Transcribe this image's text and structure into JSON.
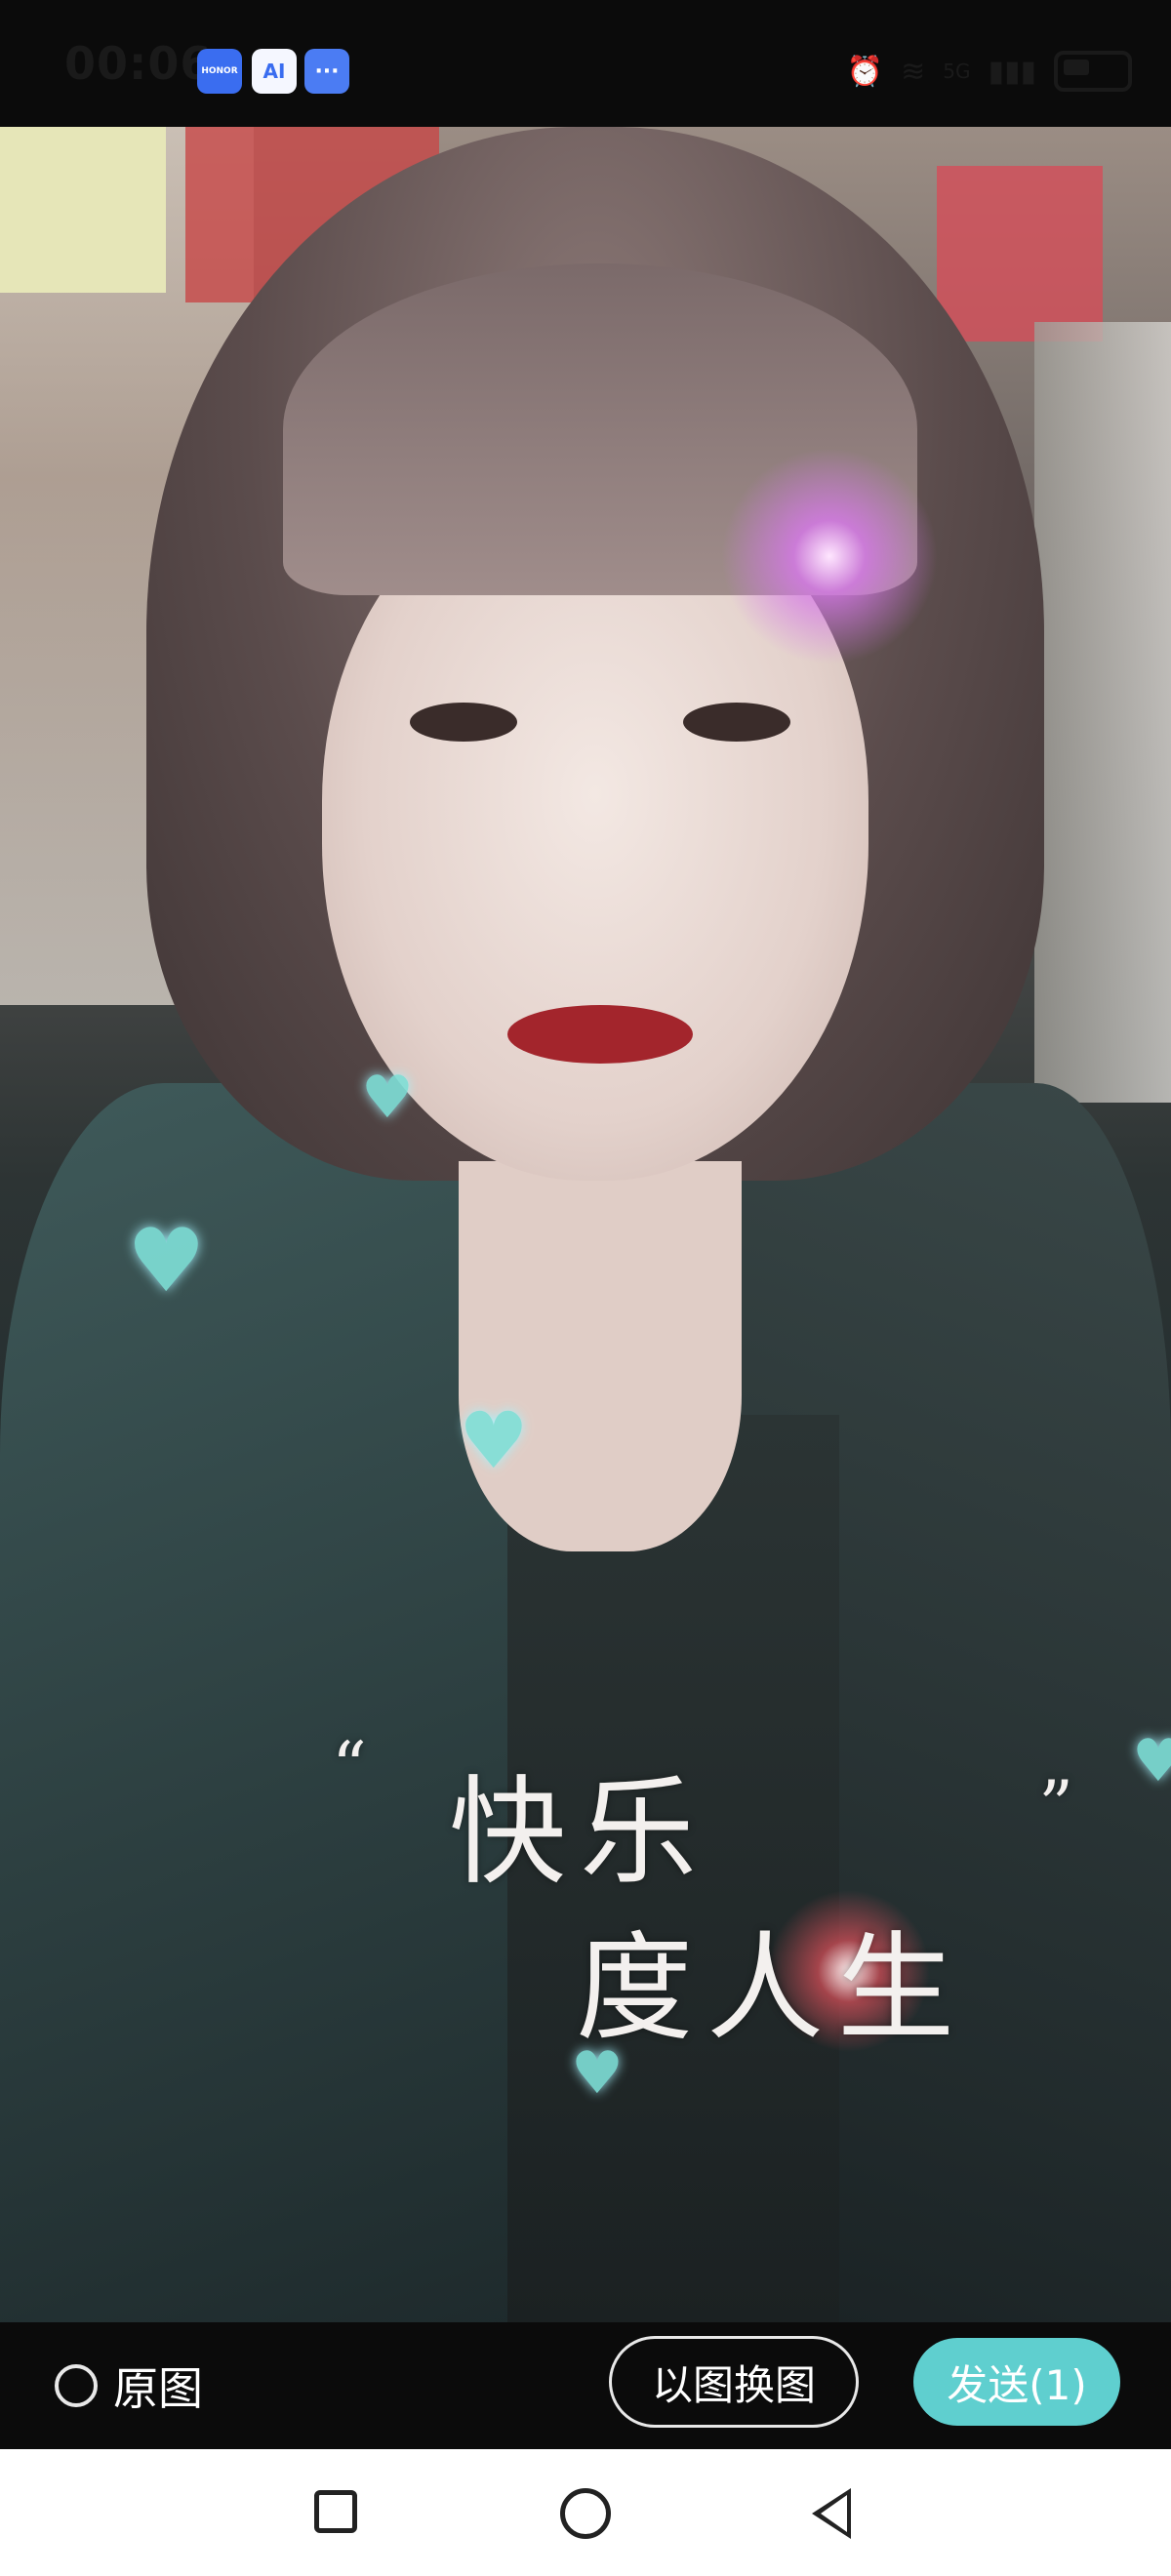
{
  "status_bar": {
    "time": "00:06",
    "apps": [
      {
        "name": "honor-app-icon",
        "label": "HONOR"
      },
      {
        "name": "ai-app-icon",
        "label": "AI"
      },
      {
        "name": "message-app-icon",
        "label": "···"
      }
    ],
    "network": "5G",
    "icons": [
      "alarm-icon",
      "wifi-icon",
      "signal-icon",
      "battery-icon"
    ]
  },
  "photo": {
    "overlay_text": {
      "quote_open": "“",
      "line1": "快乐",
      "line2": "度人生",
      "quote_close": "”"
    }
  },
  "action_bar": {
    "original_label": "原图",
    "swap_button": "以图换图",
    "send_button": "发送(1)"
  },
  "nav_bar": {
    "icons": [
      "recent-apps-icon",
      "home-icon",
      "back-icon"
    ]
  },
  "colors": {
    "accent": "#5fcfcf",
    "background": "#0b0b0b"
  }
}
